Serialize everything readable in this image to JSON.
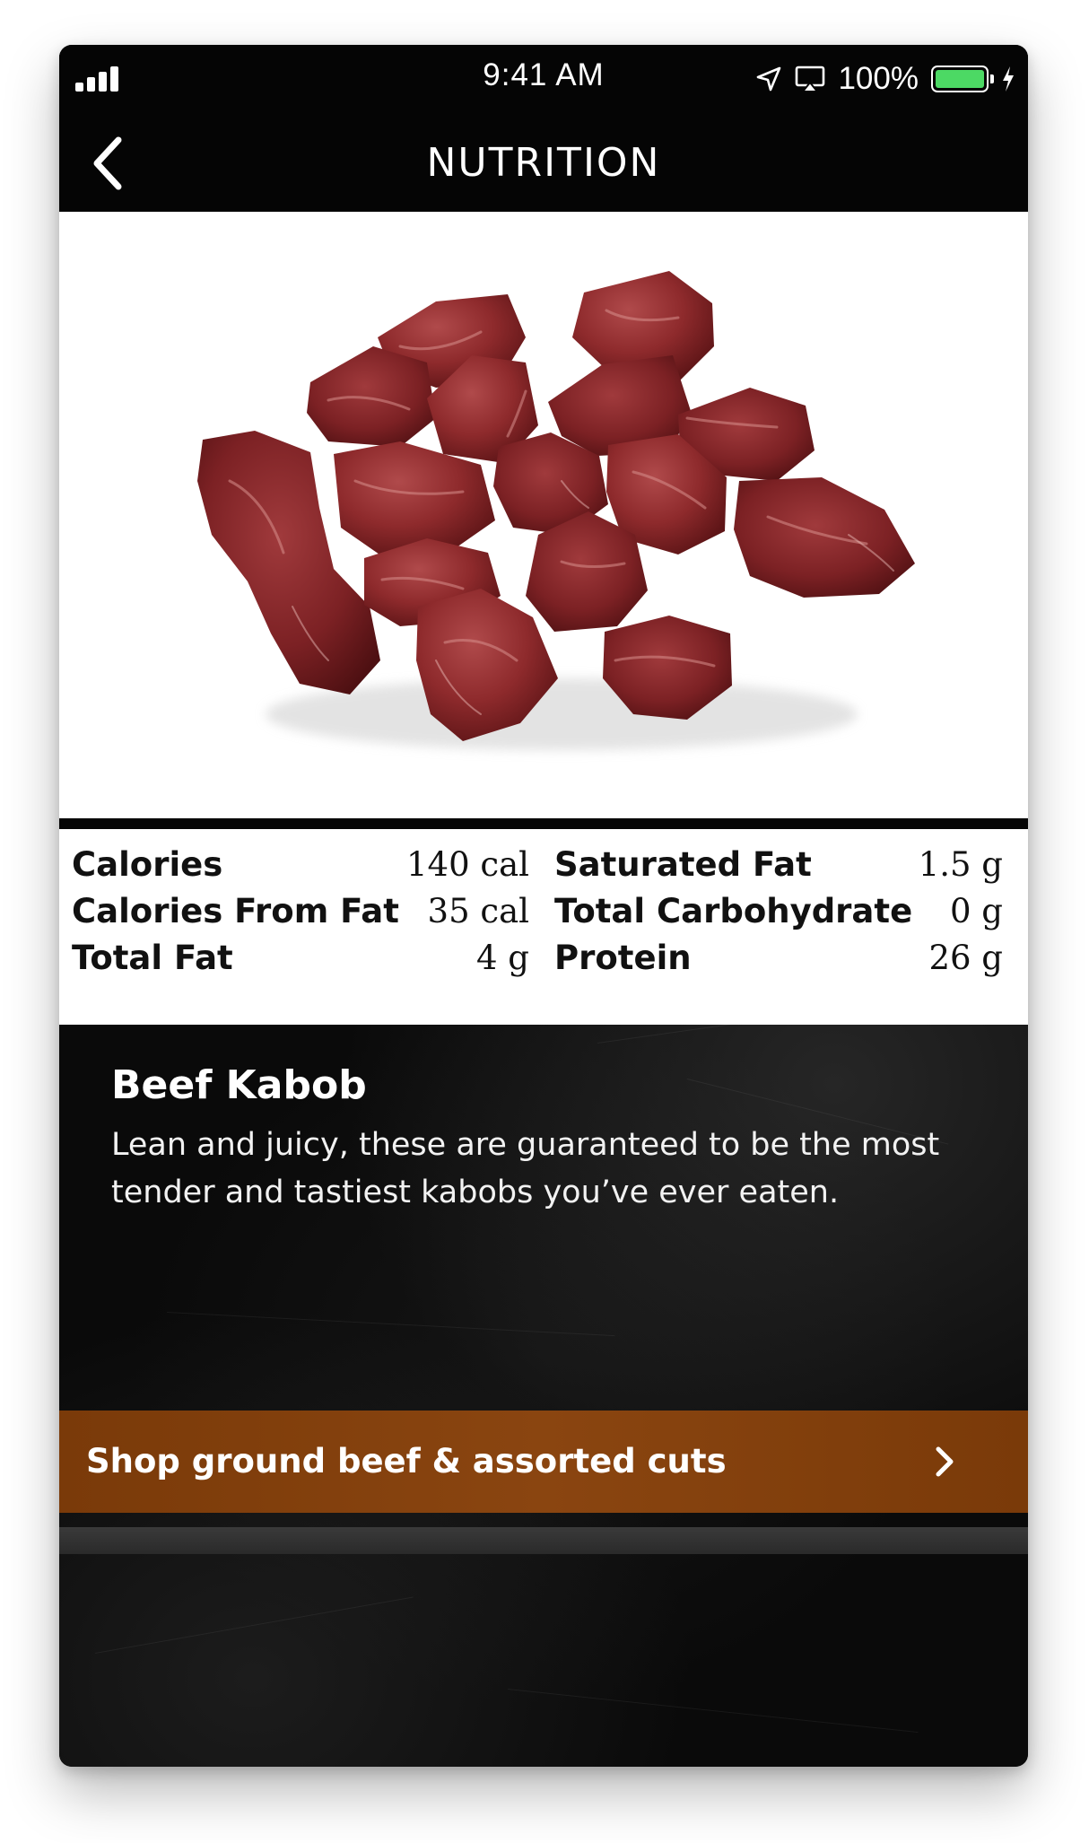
{
  "status_bar": {
    "time": "9:41 AM",
    "battery_percent": "100%",
    "icons": [
      "cellular-signal-icon",
      "location-arrow-icon",
      "airplay-icon",
      "battery-icon",
      "charging-bolt-icon"
    ]
  },
  "nav": {
    "title": "NUTRITION",
    "back_icon": "chevron-left-icon"
  },
  "hero_image": {
    "subject": "raw beef kabob cubes on white background"
  },
  "nutrition": {
    "left": [
      {
        "label": "Calories",
        "value": "140 cal"
      },
      {
        "label": "Calories From Fat",
        "value": "35 cal"
      },
      {
        "label": "Total Fat",
        "value": "4 g"
      }
    ],
    "right": [
      {
        "label": "Saturated Fat",
        "value": "1.5 g"
      },
      {
        "label": "Total Carbohydrate",
        "value": "0 g"
      },
      {
        "label": "Protein",
        "value": "26 g"
      }
    ]
  },
  "product": {
    "title": "Beef Kabob",
    "description": "Lean and juicy, these are guaranteed to be the most tender and tastiest kabobs you’ve ever eaten."
  },
  "shop": {
    "label": "Shop ground beef & assorted cuts",
    "icon": "chevron-right-icon"
  },
  "colors": {
    "nav_background": "#050505",
    "shop_button": "#7f3f0c",
    "battery_fill": "#4cd964",
    "meat": "#8e2a2c"
  }
}
